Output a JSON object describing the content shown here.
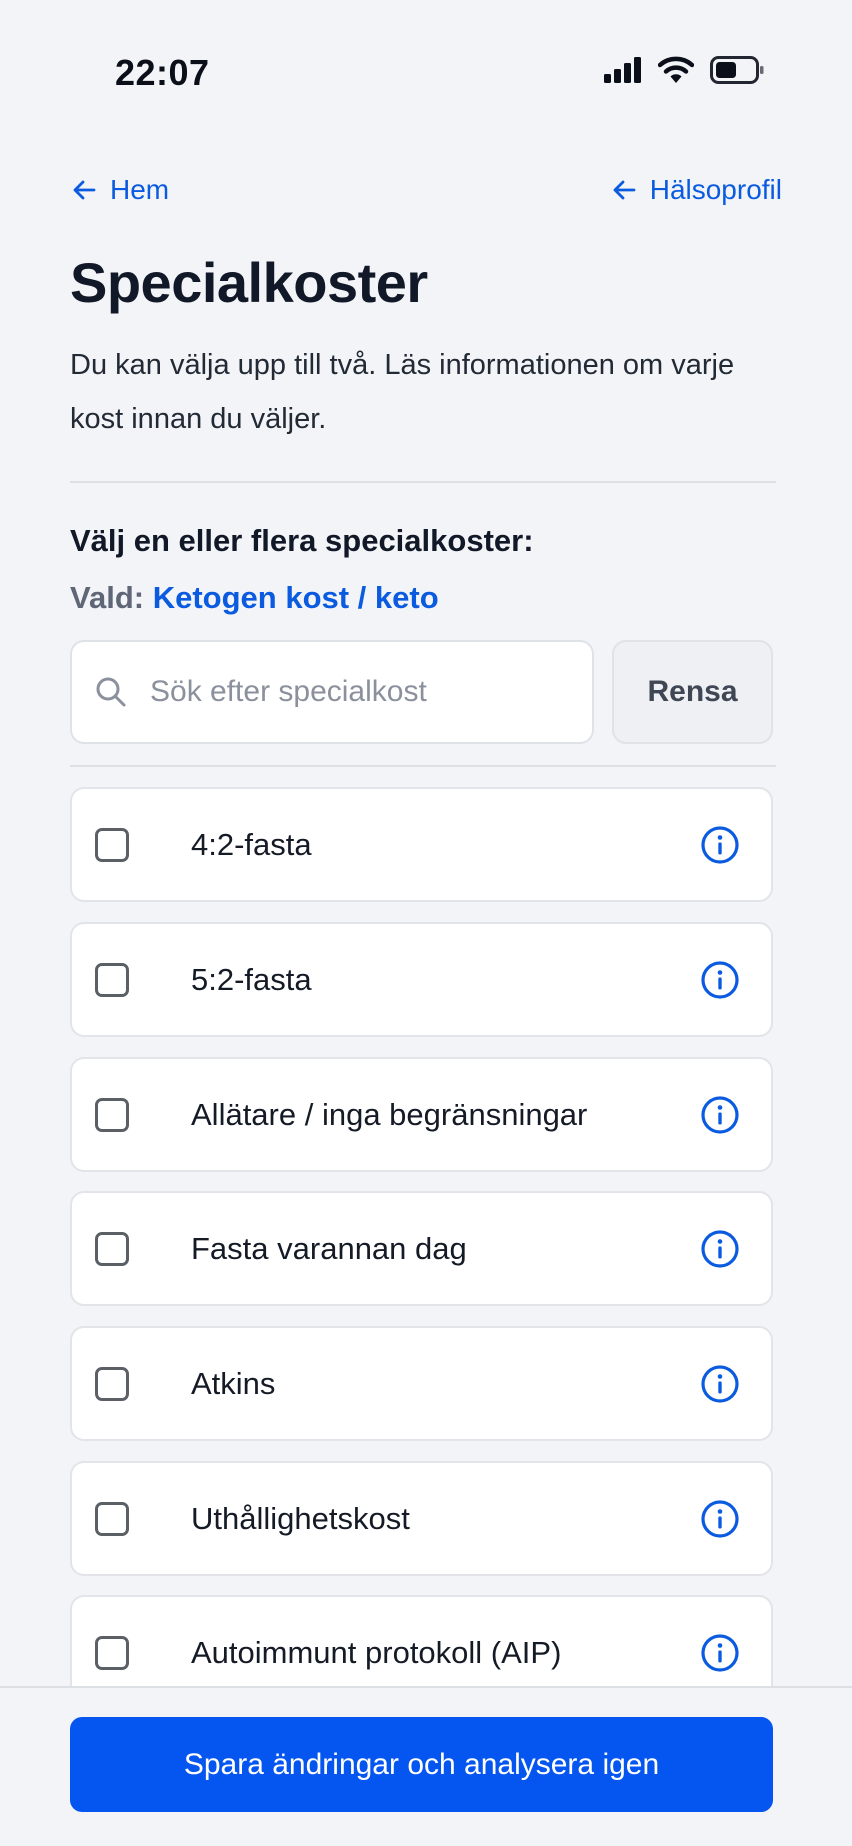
{
  "status_bar": {
    "time": "22:07"
  },
  "nav": {
    "back_home": "Hem",
    "back_profile": "Hälsoprofil"
  },
  "page": {
    "title": "Specialkoster",
    "subtitle": "Du kan välja upp till två. Läs informationen om varje kost innan du väljer."
  },
  "selection": {
    "heading": "Välj en eller flera specialkoster:",
    "selected_label": "Vald:",
    "selected_value": "Ketogen kost / keto"
  },
  "search": {
    "placeholder": "Sök efter specialkost",
    "value": "",
    "clear_label": "Rensa"
  },
  "diets": [
    {
      "label": "4:2-fasta",
      "checked": false
    },
    {
      "label": "5:2-fasta",
      "checked": false
    },
    {
      "label": "Allätare / inga begränsningar",
      "checked": false
    },
    {
      "label": "Fasta varannan dag",
      "checked": false
    },
    {
      "label": "Atkins",
      "checked": false
    },
    {
      "label": "Uthållighetskost",
      "checked": false
    },
    {
      "label": "Autoimmunt protokoll (AIP)",
      "checked": false
    }
  ],
  "footer": {
    "save_label": "Spara ändringar och analysera igen"
  },
  "colors": {
    "accent": "#0a5be0",
    "primary_button": "#0556f0",
    "background": "#f3f4f7"
  },
  "icons": {
    "nav": "arrow-left-icon",
    "search": "search-icon",
    "info": "info-icon",
    "status": [
      "cellular-signal-icon",
      "wifi-icon",
      "battery-icon"
    ]
  }
}
